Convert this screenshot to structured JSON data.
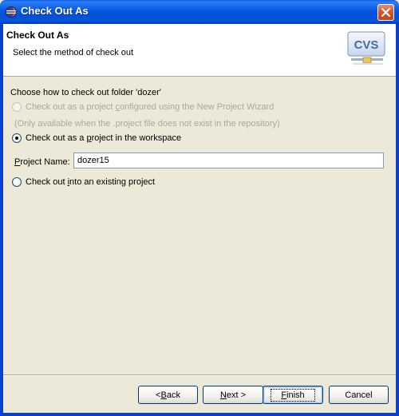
{
  "window": {
    "title": "Check Out As",
    "icon": "eclipse-icon",
    "close_icon": "close-icon"
  },
  "banner": {
    "title": "Check Out As",
    "description": "Select the method of check out",
    "graphic_label": "CVS",
    "graphic_icon": "cvs-icon"
  },
  "content": {
    "prompt": "Choose how to check out folder 'dozer'",
    "options": [
      {
        "pre": "Check out as a project ",
        "mnemonic": "c",
        "post": "onfigured using the New Project Wizard",
        "enabled": false,
        "selected": false
      },
      {
        "pre": "Check out as a ",
        "mnemonic": "p",
        "post": "roject in the workspace",
        "enabled": true,
        "selected": true
      },
      {
        "pre": "Check out ",
        "mnemonic": "i",
        "post": "nto an existing project",
        "enabled": true,
        "selected": false
      }
    ],
    "note": "(Only available when the .project file does not exist in the repository)",
    "project_name": {
      "label_mnemonic": "P",
      "label_rest": "roject Name:",
      "value": "dozer15"
    }
  },
  "buttons": {
    "back": {
      "pre": "< ",
      "mnemonic": "B",
      "post": "ack"
    },
    "next": {
      "pre": "",
      "mnemonic": "N",
      "post": "ext >"
    },
    "finish": {
      "pre": "",
      "mnemonic": "F",
      "post": "inish"
    },
    "cancel": {
      "pre": "",
      "mnemonic": "",
      "post": "Cancel"
    }
  },
  "colors": {
    "titlebar": "#0558e0",
    "frame": "#0841d0",
    "dialog_bg": "#ece9d8",
    "disabled_text": "#aca899",
    "radio_check": "#21a121"
  }
}
